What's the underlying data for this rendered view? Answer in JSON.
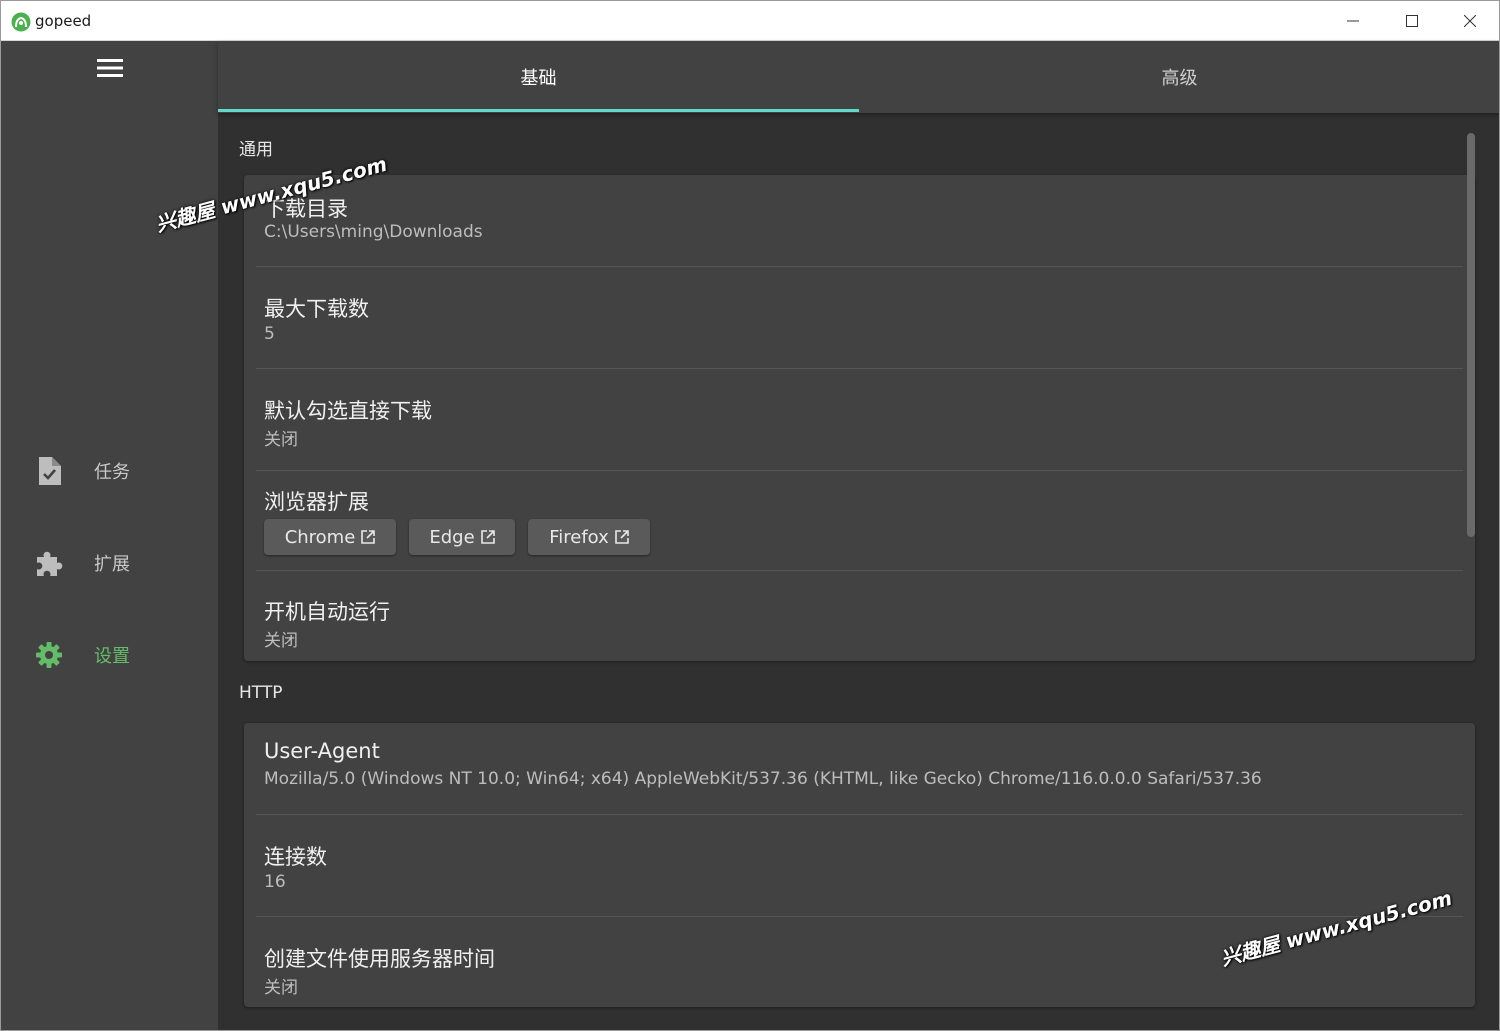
{
  "window": {
    "title": "gopeed"
  },
  "sidebar": {
    "items": [
      {
        "label": "任务",
        "icon": "file-check-icon"
      },
      {
        "label": "扩展",
        "icon": "puzzle-icon"
      },
      {
        "label": "设置",
        "icon": "gear-icon"
      }
    ]
  },
  "tabs": [
    {
      "label": "基础",
      "active": true
    },
    {
      "label": "高级",
      "active": false
    }
  ],
  "sections": {
    "general": {
      "title": "通用",
      "rows": [
        {
          "title": "下载目录",
          "value": "C:\\Users\\ming\\Downloads"
        },
        {
          "title": "最大下载数",
          "value": "5"
        },
        {
          "title": "默认勾选直接下载",
          "value": "关闭"
        },
        {
          "title": "浏览器扩展",
          "buttons": [
            "Chrome",
            "Edge",
            "Firefox"
          ]
        },
        {
          "title": "开机自动运行",
          "value": "关闭"
        }
      ]
    },
    "http": {
      "title": "HTTP",
      "rows": [
        {
          "title": "User-Agent",
          "value": "Mozilla/5.0 (Windows NT 10.0; Win64; x64) AppleWebKit/537.36 (KHTML, like Gecko) Chrome/116.0.0.0 Safari/537.36"
        },
        {
          "title": "连接数",
          "value": "16"
        },
        {
          "title": "创建文件使用服务器时间",
          "value": "关闭"
        }
      ]
    }
  },
  "watermark": "兴趣屋 www.xqu5.com",
  "colors": {
    "accent": "#64d8c8",
    "active_nav": "#66bb6a",
    "card": "#424242",
    "background": "#303030"
  }
}
